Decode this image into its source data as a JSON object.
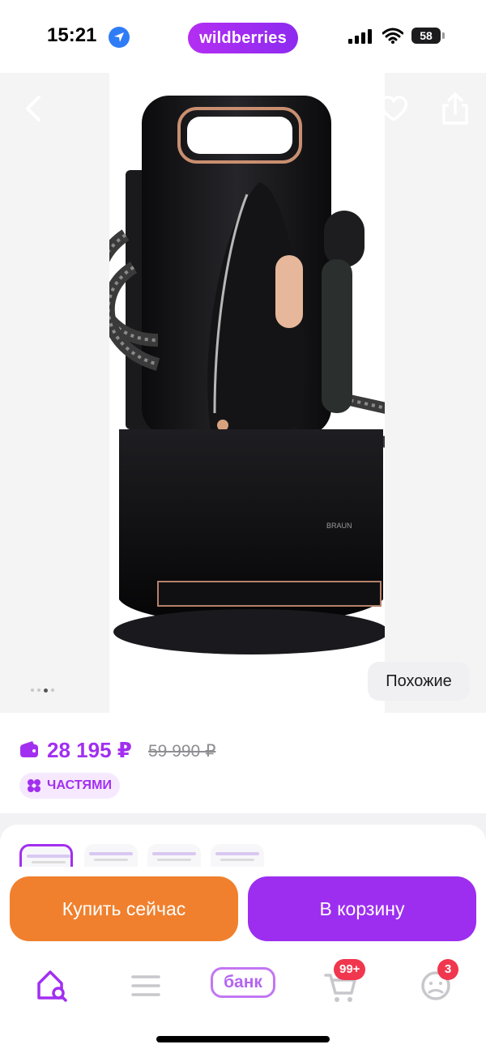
{
  "status_bar": {
    "time": "15:21",
    "brand": "wildberries",
    "battery": "58",
    "icons": [
      "location-arrow-icon",
      "signal-icon",
      "wifi-icon",
      "battery-icon"
    ]
  },
  "product_photo": {
    "image_alt": "Braun CareStyle steam generator iron",
    "brand_mark": "BRAUN",
    "similar_label": "Похожие",
    "carousel_dots": 4,
    "active_dot": 2,
    "icons": [
      "back-icon",
      "heart-icon",
      "share-icon"
    ]
  },
  "price": {
    "current": "28 195 ₽",
    "old": "59 990 ₽",
    "installment_label": "ЧАСТЯМИ",
    "icons": [
      "wallet-icon",
      "installment-icon"
    ]
  },
  "actions": {
    "buy_now_label": "Купить сейчас",
    "to_cart_label": "В корзину"
  },
  "bottom_nav": {
    "bank_label": "банк",
    "cart_badge": "99+",
    "profile_badge": "3",
    "icons": [
      "home-search-icon",
      "menu-icon",
      "cart-icon",
      "profile-icon"
    ]
  },
  "colors": {
    "accent": "#a22ff0",
    "buy_now": "#f0802e",
    "to_cart": "#9d2ef0",
    "badge": "#f0374e"
  }
}
